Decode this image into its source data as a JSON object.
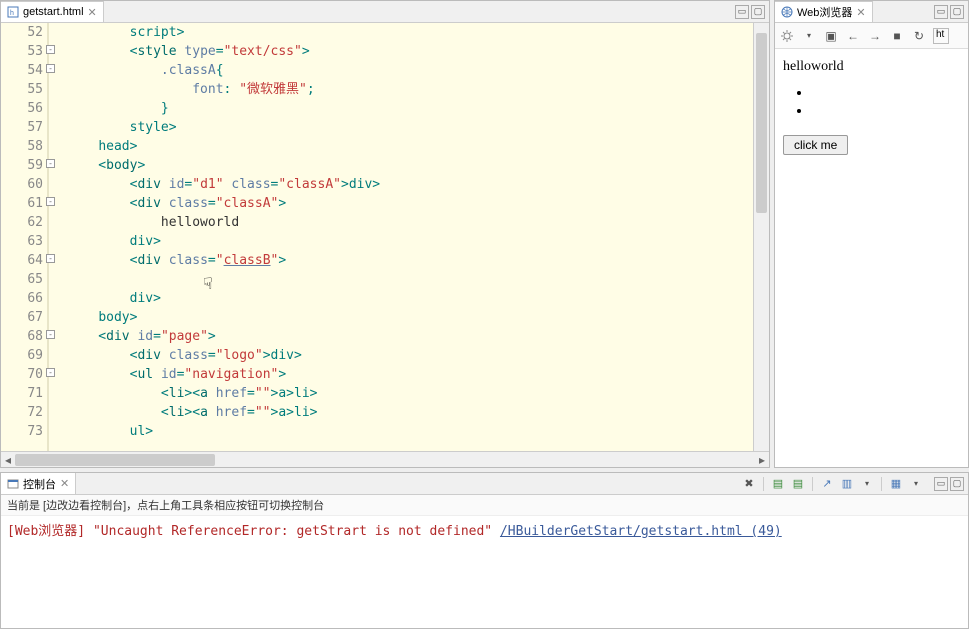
{
  "editor": {
    "tab_title": "getstart.html",
    "lines": [
      {
        "n": 52,
        "fold": "",
        "html": "        </<span class='tag-name'>script</span>>"
      },
      {
        "n": 53,
        "fold": "-",
        "html": "        <<span class='tag-name'>style</span> <span class='attr-name'>type</span>=<span class='attr-val'>\"text/css\"</span>>"
      },
      {
        "n": 54,
        "fold": "-",
        "html": "            <span class='js-key'>.classA</span>{"
      },
      {
        "n": 55,
        "fold": "",
        "html": "                <span class='attr-name'>font</span>: <span class='attr-val'>\"微软雅黑\"</span>;"
      },
      {
        "n": 56,
        "fold": "",
        "html": "            }"
      },
      {
        "n": 57,
        "fold": "",
        "html": "        </<span class='tag-name'>style</span>>"
      },
      {
        "n": 58,
        "fold": "",
        "html": "    </<span class='tag-name'>head</span>>"
      },
      {
        "n": 59,
        "fold": "-",
        "html": "    <<span class='tag-name'>body</span>>"
      },
      {
        "n": 60,
        "fold": "",
        "html": "        <<span class='tag-name'>div</span> <span class='attr-name'>id</span>=<span class='attr-val'>\"d1\"</span> <span class='attr-name'>class</span>=<span class='attr-val'>\"classA\"</span>></<span class='tag-name'>div</span>>"
      },
      {
        "n": 61,
        "fold": "-",
        "html": "        <<span class='tag-name'>div</span> <span class='attr-name'>class</span>=<span class='attr-val'>\"classA\"</span>>"
      },
      {
        "n": 62,
        "fold": "",
        "html": "            <span class='plain'>helloworld</span>"
      },
      {
        "n": 63,
        "fold": "",
        "html": "        </<span class='tag-name'>div</span>>"
      },
      {
        "n": 64,
        "fold": "-",
        "html": "        <<span class='tag-name'>div</span> <span class='attr-name'>class</span>=<span class='attr-val'>\"<span class='under'>classB</span>\"</span>>"
      },
      {
        "n": 65,
        "fold": "",
        "html": "            "
      },
      {
        "n": 66,
        "fold": "",
        "html": "        </<span class='tag-name'>div</span>>"
      },
      {
        "n": 67,
        "fold": "",
        "html": "    </<span class='tag-name'>body</span>>"
      },
      {
        "n": 68,
        "fold": "-",
        "html": "    <<span class='tag-name'>div</span> <span class='attr-name'>id</span>=<span class='attr-val'>\"page\"</span>>"
      },
      {
        "n": 69,
        "fold": "",
        "html": "        <<span class='tag-name'>div</span> <span class='attr-name'>class</span>=<span class='attr-val'>\"logo\"</span>></<span class='tag-name'>div</span>>"
      },
      {
        "n": 70,
        "fold": "-",
        "html": "        <<span class='tag-name'>ul</span> <span class='attr-name'>id</span>=<span class='attr-val'>\"navigation\"</span>>"
      },
      {
        "n": 71,
        "fold": "",
        "html": "            <<span class='tag-name'>li</span>><<span class='tag-name'>a</span> <span class='attr-name'>href</span>=<span class='attr-val'>\"\"</span>></<span class='tag-name'>a</span>></<span class='tag-name'>li</span>>"
      },
      {
        "n": 72,
        "fold": "",
        "html": "            <<span class='tag-name'>li</span>><<span class='tag-name'>a</span> <span class='attr-name'>href</span>=<span class='attr-val'>\"\"</span>></<span class='tag-name'>a</span>></<span class='tag-name'>li</span>>"
      },
      {
        "n": 73,
        "fold": "",
        "html": "        </<span class='tag-name'>ul</span>>"
      }
    ]
  },
  "browser": {
    "tab_title": "Web浏览器",
    "url_fragment": "ht",
    "content_text": "helloworld",
    "button_label": "click me"
  },
  "console": {
    "tab_title": "控制台",
    "hint": "当前是 [边改边看控制台]，点右上角工具条相应按钮可切换控制台",
    "source": "[Web浏览器]",
    "message": "\"Uncaught ReferenceError: getStrart is not defined\"",
    "link": "/HBuilderGetStart/getstart.html (49)"
  }
}
